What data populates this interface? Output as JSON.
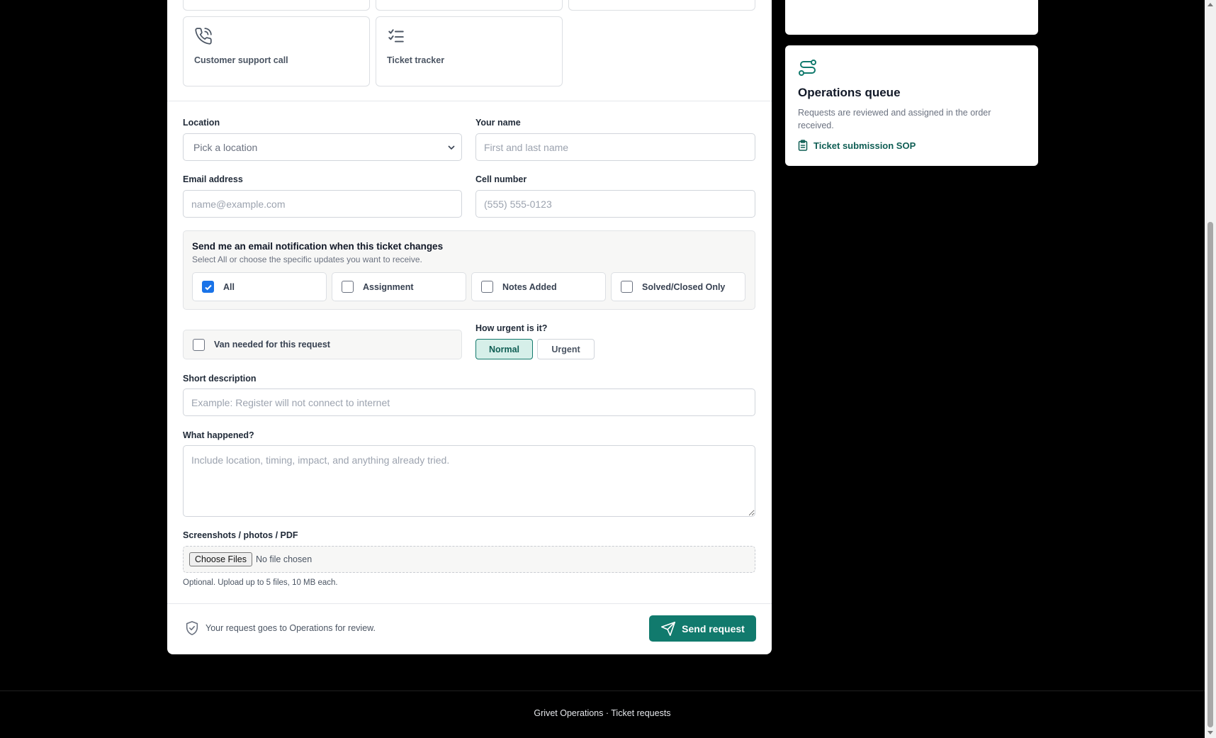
{
  "tiles": [
    {
      "label": "Customer support call",
      "icon": "phone-call-icon"
    },
    {
      "label": "Ticket tracker",
      "icon": "checklist-icon"
    }
  ],
  "form": {
    "location": {
      "label": "Location",
      "placeholder": "Pick a location"
    },
    "name": {
      "label": "Your name",
      "placeholder": "First and last name"
    },
    "email": {
      "label": "Email address",
      "placeholder": "name@example.com"
    },
    "cell": {
      "label": "Cell number",
      "placeholder": "(555) 555-0123"
    },
    "notifications": {
      "title": "Send me an email notification when this ticket changes",
      "subtitle": "Select All or choose the specific updates you want to receive.",
      "options": [
        {
          "label": "All",
          "checked": true
        },
        {
          "label": "Assignment",
          "checked": false
        },
        {
          "label": "Notes Added",
          "checked": false
        },
        {
          "label": "Solved/Closed Only",
          "checked": false
        }
      ]
    },
    "van": {
      "label": "Van needed for this request",
      "checked": false
    },
    "urgency": {
      "label": "How urgent is it?",
      "options": [
        "Normal",
        "Urgent"
      ],
      "selected": "Normal"
    },
    "short_description": {
      "label": "Short description",
      "placeholder": "Example: Register will not connect to internet"
    },
    "what_happened": {
      "label": "What happened?",
      "placeholder": "Include location, timing, impact, and anything already tried."
    },
    "attachments": {
      "label": "Screenshots / photos / PDF",
      "button": "Choose Files",
      "status": "No file chosen",
      "help": "Optional. Upload up to 5 files, 10 MB each."
    },
    "review_note": "Your request goes to Operations for review.",
    "submit_label": "Send request"
  },
  "side": {
    "title": "Operations queue",
    "description": "Requests are reviewed and assigned in the order received.",
    "link": "Ticket submission SOP"
  },
  "footer": {
    "text": "Grivet Operations · Ticket requests"
  },
  "colors": {
    "accent": "#117a6d",
    "accent_light": "#d6efe9",
    "checkbox": "#1a73e8",
    "background": "#000000"
  }
}
